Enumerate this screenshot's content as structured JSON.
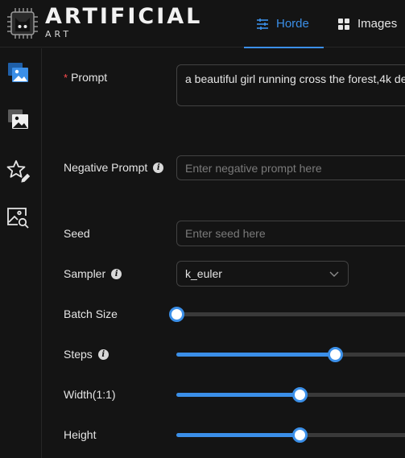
{
  "app": {
    "brand": "ARTIFICIAL",
    "brand_sub": "ART"
  },
  "tabs": [
    {
      "label": "Horde",
      "active": true
    },
    {
      "label": "Images",
      "active": false
    }
  ],
  "sidebar": {
    "items": [
      {
        "icon": "image-generate-icon",
        "active": true
      },
      {
        "icon": "image-gallery-icon",
        "active": false
      },
      {
        "icon": "star-edit-icon",
        "active": false
      },
      {
        "icon": "image-search-icon",
        "active": false
      }
    ]
  },
  "form": {
    "prompt": {
      "required_mark": "*",
      "label": "Prompt",
      "value": "a beautiful girl running cross the forest,4k de"
    },
    "negative_prompt": {
      "label": "Negative Prompt",
      "placeholder": "Enter negative prompt here"
    },
    "seed": {
      "label": "Seed",
      "placeholder": "Enter seed here"
    },
    "sampler": {
      "label": "Sampler",
      "value": "k_euler"
    },
    "batch_size": {
      "label": "Batch Size",
      "fraction": 0.0
    },
    "steps": {
      "label": "Steps",
      "fraction": 0.655
    },
    "width": {
      "label": "Width(1:1)",
      "fraction": 0.51
    },
    "height": {
      "label": "Height",
      "fraction": 0.51
    }
  },
  "colors": {
    "accent": "#3b8fe8",
    "background": "#141414",
    "required": "#ff4d4f"
  }
}
